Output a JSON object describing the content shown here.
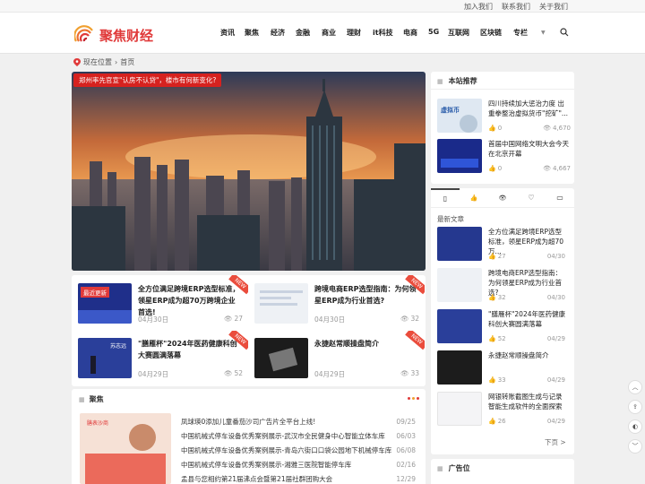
{
  "topbar": {
    "links": [
      "加入我们",
      "联系我们",
      "关于我们"
    ]
  },
  "brand": {
    "name": "聚焦财经",
    "accent": "#e03a3a"
  },
  "nav": {
    "items": [
      "资讯",
      "聚焦",
      "经济",
      "金融",
      "商业",
      "理财",
      "it科技",
      "电商",
      "5G",
      "互联网",
      "区块链",
      "专栏"
    ]
  },
  "breadcrumb": {
    "current": "现在位置",
    "home": "首页"
  },
  "hero": {
    "caption": "郑州率先官宣\"认房不认贷\"，楼市有何新变化?"
  },
  "posts": [
    {
      "title": "全方位满足跨境ERP选型标准，领星ERP成为超70万跨境企业首选!",
      "date": "04月30日",
      "views": "27",
      "badge": "NEW",
      "thumb_text": "最近更新"
    },
    {
      "title": "跨境电商ERP选型指南：为何领星ERP成为行业首选?",
      "date": "04月30日",
      "views": "32",
      "badge": "NEW",
      "thumb_text": ""
    },
    {
      "title": "\"膳雁杯\"2024年医药健康科创大赛圆满落幕",
      "date": "04月29日",
      "views": "52",
      "badge": "NEW",
      "thumb_text": "苏志远"
    },
    {
      "title": "永捷赵常顺操盘简介",
      "date": "04月29日",
      "views": "33",
      "badge": "NEW",
      "thumb_text": ""
    }
  ],
  "focus": {
    "heading": "聚焦",
    "image_text": "膳表沙商",
    "items": [
      {
        "title": "凤球瑛0添加儿童番茄沙司广告片全平台上线!",
        "date": "09/25"
      },
      {
        "title": "中国机械式停车设备优秀案例展示-武汉市全民健身中心智能立体车库",
        "date": "06/03"
      },
      {
        "title": "中国机械式停车设备优秀案例展示-青岛六街口口袋公园地下机械停车库",
        "date": "06/08"
      },
      {
        "title": "中国机械式停车设备优秀案例展示-湘雅三医院智能停车库",
        "date": "02/16"
      },
      {
        "title": "孟县与您相约第21届沸点会暨第21届社群团购大会",
        "date": "12/29"
      }
    ]
  },
  "recommend": {
    "heading": "本站推荐",
    "items": [
      {
        "title": "四川持续加大惩治力度 出重拳整治虚拟货币\"挖矿\"...",
        "likes": "0",
        "views": "4,670",
        "thumb_text": "虚拟币"
      },
      {
        "title": "首届中国网络文明大会今天在北京开幕",
        "likes": "0",
        "views": "4,667",
        "thumb_text": ""
      }
    ]
  },
  "latest": {
    "heading": "最新文章",
    "items": [
      {
        "title": "全方位满足跨境ERP选型标准，领星ERP成为超70万...",
        "likes": "27",
        "date": "04/30"
      },
      {
        "title": "跨境电商ERP选型指南：为何领星ERP成为行业首选?",
        "likes": "32",
        "date": "04/30"
      },
      {
        "title": "\"膳雁杯\"2024年医药健康科创大赛圆满落幕",
        "likes": "52",
        "date": "04/29"
      },
      {
        "title": "永捷赵常顺操盘简介",
        "likes": "33",
        "date": "04/29"
      },
      {
        "title": "网银转账截图生成与记录智能生成软件的全面探索",
        "likes": "26",
        "date": "04/29"
      }
    ],
    "next": "下页 >"
  },
  "ads": {
    "heading": "广告位"
  }
}
